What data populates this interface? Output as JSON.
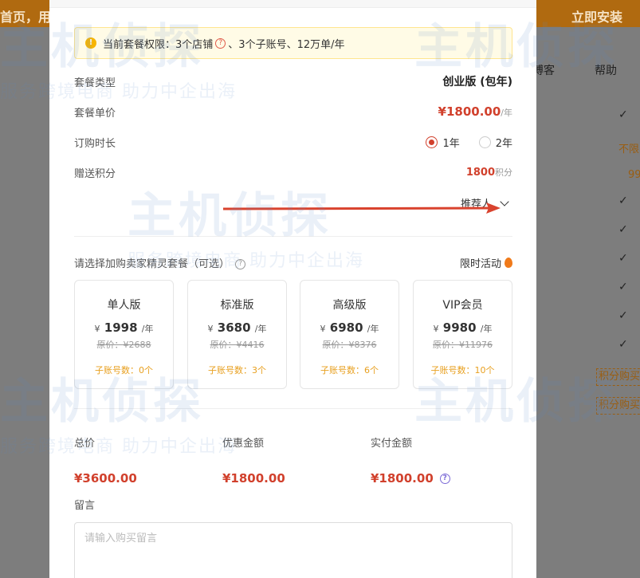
{
  "background": {
    "banner_left": "首页，用",
    "banner_right": "立即安装",
    "nav_item_1": "博客",
    "nav_item_2": "帮助",
    "right_text_1": "不限",
    "right_text_2": "99",
    "buy_button_1": "积分购买",
    "buy_button_2": "积分购买"
  },
  "notice": {
    "text_prefix": "当前套餐权限：",
    "stores": "3个店铺",
    "text_suffix": "、3个子账号、12万单/年"
  },
  "plan": {
    "type_label": "套餐类型",
    "type_value": "创业版 (包年)",
    "price_label": "套餐单价",
    "price_value": "¥1800.00",
    "price_unit": "/年",
    "duration_label": "订购时长",
    "duration_options": [
      "1年",
      "2年"
    ],
    "duration_selected": "1年",
    "points_label": "赠送积分",
    "points_value": "1800",
    "points_unit": "积分",
    "referrer_label": "推荐人"
  },
  "addons": {
    "title": "请选择加购卖家精灵套餐（可选）",
    "promo": "限时活动",
    "cards": [
      {
        "name": "单人版",
        "currency": "¥",
        "price": "1998",
        "per": "/年",
        "original": "原价：¥2688",
        "subaccounts": "子账号数：0个"
      },
      {
        "name": "标准版",
        "currency": "¥",
        "price": "3680",
        "per": "/年",
        "original": "原价：¥4416",
        "subaccounts": "子账号数：3个"
      },
      {
        "name": "高级版",
        "currency": "¥",
        "price": "6980",
        "per": "/年",
        "original": "原价：¥8376",
        "subaccounts": "子账号数：6个"
      },
      {
        "name": "VIP会员",
        "currency": "¥",
        "price": "9980",
        "per": "/年",
        "original": "原价：¥11976",
        "subaccounts": "子账号数：10个"
      }
    ]
  },
  "totals": {
    "total_label": "总价",
    "total_value": "¥3600.00",
    "discount_label": "优惠金额",
    "discount_value": "¥1800.00",
    "paid_label": "实付金额",
    "paid_value": "¥1800.00"
  },
  "message": {
    "label": "留言",
    "placeholder": "请输入购买留言"
  },
  "watermark": {
    "brand": "主机侦探",
    "slogan": "服务跨境电商  助力中企出海"
  },
  "colors": {
    "accent": "#d1402c",
    "notice_bg": "#fffbe6",
    "subaccount": "#e8a020"
  }
}
